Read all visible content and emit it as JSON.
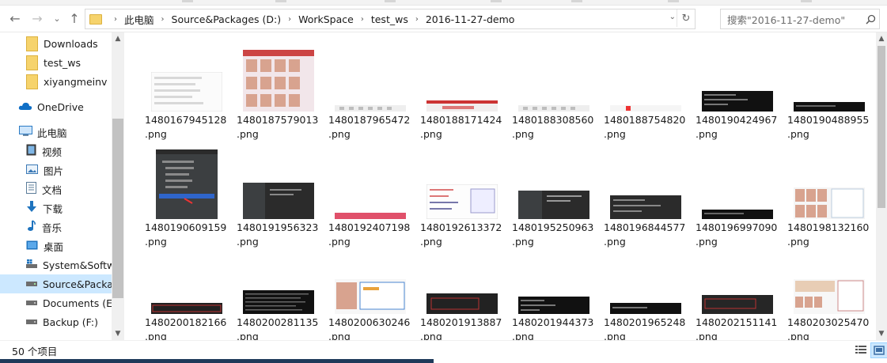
{
  "nav": {
    "back": "←",
    "forward": "→",
    "recent": "⌄",
    "up": "↑"
  },
  "address": {
    "breadcrumbs": [
      "此电脑",
      "Source&Packages (D:)",
      "WorkSpace",
      "test_ws",
      "2016-11-27-demo"
    ],
    "dropdown": "⌄",
    "refresh": "↻"
  },
  "search": {
    "placeholder": "搜索\"2016-11-27-demo\""
  },
  "sidebar": {
    "items": [
      {
        "label": "Downloads",
        "icon": "folder-icon"
      },
      {
        "label": "test_ws",
        "icon": "folder-icon"
      },
      {
        "label": "xiyangmeinv",
        "icon": "folder-icon"
      },
      {
        "label": "OneDrive",
        "icon": "onedrive-cloud-icon"
      },
      {
        "label": "此电脑",
        "icon": "this-pc-icon"
      },
      {
        "label": "视频",
        "icon": "videos-icon"
      },
      {
        "label": "图片",
        "icon": "pictures-icon"
      },
      {
        "label": "文档",
        "icon": "documents-icon"
      },
      {
        "label": "下载",
        "icon": "downloads-icon"
      },
      {
        "label": "音乐",
        "icon": "music-icon"
      },
      {
        "label": "桌面",
        "icon": "desktop-icon"
      },
      {
        "label": "System&Software (C:)",
        "icon": "windows-drive-icon"
      },
      {
        "label": "Source&Packages (D:)",
        "icon": "drive-icon",
        "selected": true
      },
      {
        "label": "Documents (E:)",
        "icon": "drive-icon"
      },
      {
        "label": "Backup (F:)",
        "icon": "drive-icon"
      }
    ]
  },
  "files": [
    {
      "name1": "1480167945128",
      "name2": ".png",
      "thumb": "doc-list"
    },
    {
      "name1": "1480187579013",
      "name2": ".png",
      "thumb": "photo-grid"
    },
    {
      "name1": "1480187965472",
      "name2": ".png",
      "thumb": "gray-strip"
    },
    {
      "name1": "1480188171424",
      "name2": ".png",
      "thumb": "red-strip"
    },
    {
      "name1": "1480188308560",
      "name2": ".png",
      "thumb": "gray-strip"
    },
    {
      "name1": "1480188754820",
      "name2": ".png",
      "thumb": "pink-strip"
    },
    {
      "name1": "1480190424967",
      "name2": ".png",
      "thumb": "black-console"
    },
    {
      "name1": "1480190488955",
      "name2": ".png",
      "thumb": "black-strip"
    },
    {
      "name1": "1480190609159",
      "name2": ".png",
      "thumb": "ide-tree"
    },
    {
      "name1": "1480191956323",
      "name2": ".png",
      "thumb": "dark-ide"
    },
    {
      "name1": "1480192407198",
      "name2": ".png",
      "thumb": "pink-bar"
    },
    {
      "name1": "1480192613372",
      "name2": ".png",
      "thumb": "code-light"
    },
    {
      "name1": "1480195250963",
      "name2": ".png",
      "thumb": "dark-ide2"
    },
    {
      "name1": "1480196844577",
      "name2": ".png",
      "thumb": "dark-ide3"
    },
    {
      "name1": "1480196997090",
      "name2": ".png",
      "thumb": "black-strip"
    },
    {
      "name1": "1480198132160",
      "name2": ".png",
      "thumb": "photo-code"
    },
    {
      "name1": "1480200182166",
      "name2": ".png",
      "thumb": "dark-red"
    },
    {
      "name1": "1480200281135",
      "name2": ".png",
      "thumb": "black-text"
    },
    {
      "name1": "1480200630246",
      "name2": ".png",
      "thumb": "photo-code2"
    },
    {
      "name1": "1480201913887",
      "name2": ".png",
      "thumb": "dark-red2"
    },
    {
      "name1": "1480201944373",
      "name2": ".png",
      "thumb": "black-console2"
    },
    {
      "name1": "1480201965248",
      "name2": ".png",
      "thumb": "black-console3"
    },
    {
      "name1": "1480202151141",
      "name2": ".png",
      "thumb": "dark-red3"
    },
    {
      "name1": "1480203025470",
      "name2": ".png",
      "thumb": "photo-code3"
    }
  ],
  "status": {
    "count": "50 个项目"
  },
  "colors": {
    "selection": "#cce8ff",
    "folder": "#f6d36c",
    "accent": "#0078d7"
  }
}
